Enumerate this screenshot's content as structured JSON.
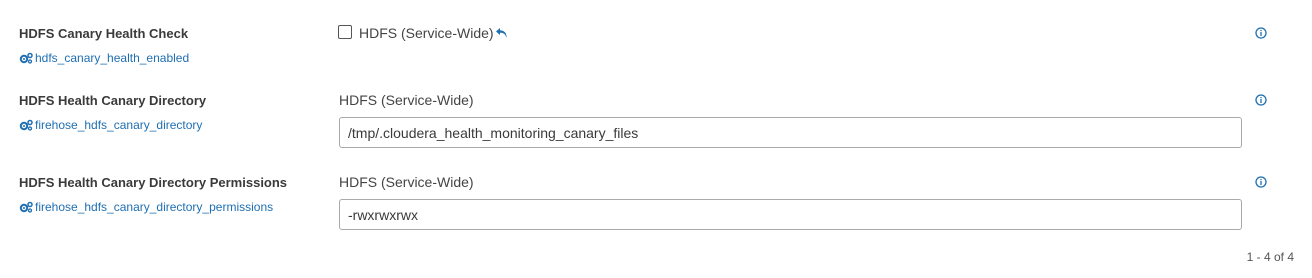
{
  "colors": {
    "link": "#1f6fb2",
    "text": "#3a3a3a",
    "input_border": "#a9a9a9"
  },
  "properties": [
    {
      "display_name": "HDFS Canary Health Check",
      "key": "hdfs_canary_health_enabled",
      "control": "checkbox",
      "checked": false,
      "scope_label": "HDFS (Service-Wide)",
      "icons": [
        "gear-icon",
        "undo-icon",
        "info-icon"
      ]
    },
    {
      "display_name": "HDFS Health Canary Directory",
      "key": "firehose_hdfs_canary_directory",
      "control": "text",
      "scope_label": "HDFS (Service-Wide)",
      "value": "/tmp/.cloudera_health_monitoring_canary_files",
      "icons": [
        "gear-icon",
        "info-icon"
      ]
    },
    {
      "display_name": "HDFS Health Canary Directory Permissions",
      "key": "firehose_hdfs_canary_directory_permissions",
      "control": "text",
      "scope_label": "HDFS (Service-Wide)",
      "value": "-rwxrwxrwx",
      "icons": [
        "gear-icon",
        "info-icon"
      ]
    }
  ],
  "pagination": {
    "text": "1 - 4 of 4"
  }
}
